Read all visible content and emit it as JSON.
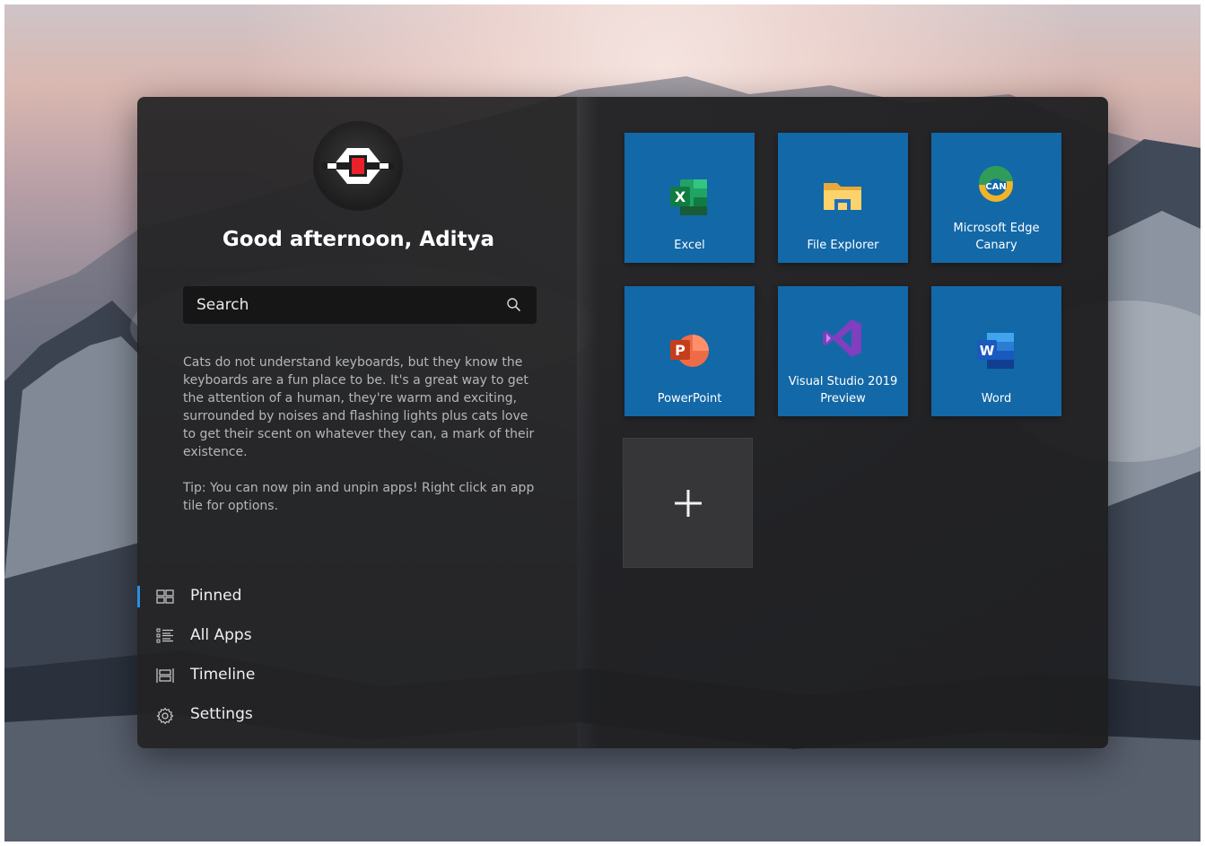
{
  "user": {
    "greeting": "Good afternoon, Aditya"
  },
  "search": {
    "label": "Search",
    "icon": "search-icon"
  },
  "fact": {
    "text": "Cats do not understand keyboards, but they know the keyboards are a fun place to be. It's a great way to get the attention of a human, they're warm and exciting, surrounded by noises and flashing lights plus cats love to get their scent on whatever they can, a mark of their existence.",
    "tip": "Tip: You can now pin and unpin apps! Right click an app tile for options."
  },
  "nav": {
    "items": [
      {
        "label": "Pinned",
        "icon": "pinned-icon",
        "selected": true
      },
      {
        "label": "All Apps",
        "icon": "list-icon",
        "selected": false
      },
      {
        "label": "Timeline",
        "icon": "timeline-icon",
        "selected": false
      },
      {
        "label": "Settings",
        "icon": "gear-icon",
        "selected": false
      }
    ]
  },
  "tiles": [
    {
      "label": "Excel",
      "icon": "excel-icon"
    },
    {
      "label": "File Explorer",
      "icon": "file-explorer-icon"
    },
    {
      "label": "Microsoft Edge Canary",
      "icon": "edge-canary-icon"
    },
    {
      "label": "PowerPoint",
      "icon": "powerpoint-icon"
    },
    {
      "label": "Visual Studio 2019 Preview",
      "icon": "visual-studio-icon"
    },
    {
      "label": "Word",
      "icon": "word-icon"
    }
  ],
  "add_tile": {
    "icon": "plus-icon"
  },
  "colors": {
    "tile": "#1368a7",
    "accent": "#2a8de8",
    "panel": "#222224"
  }
}
